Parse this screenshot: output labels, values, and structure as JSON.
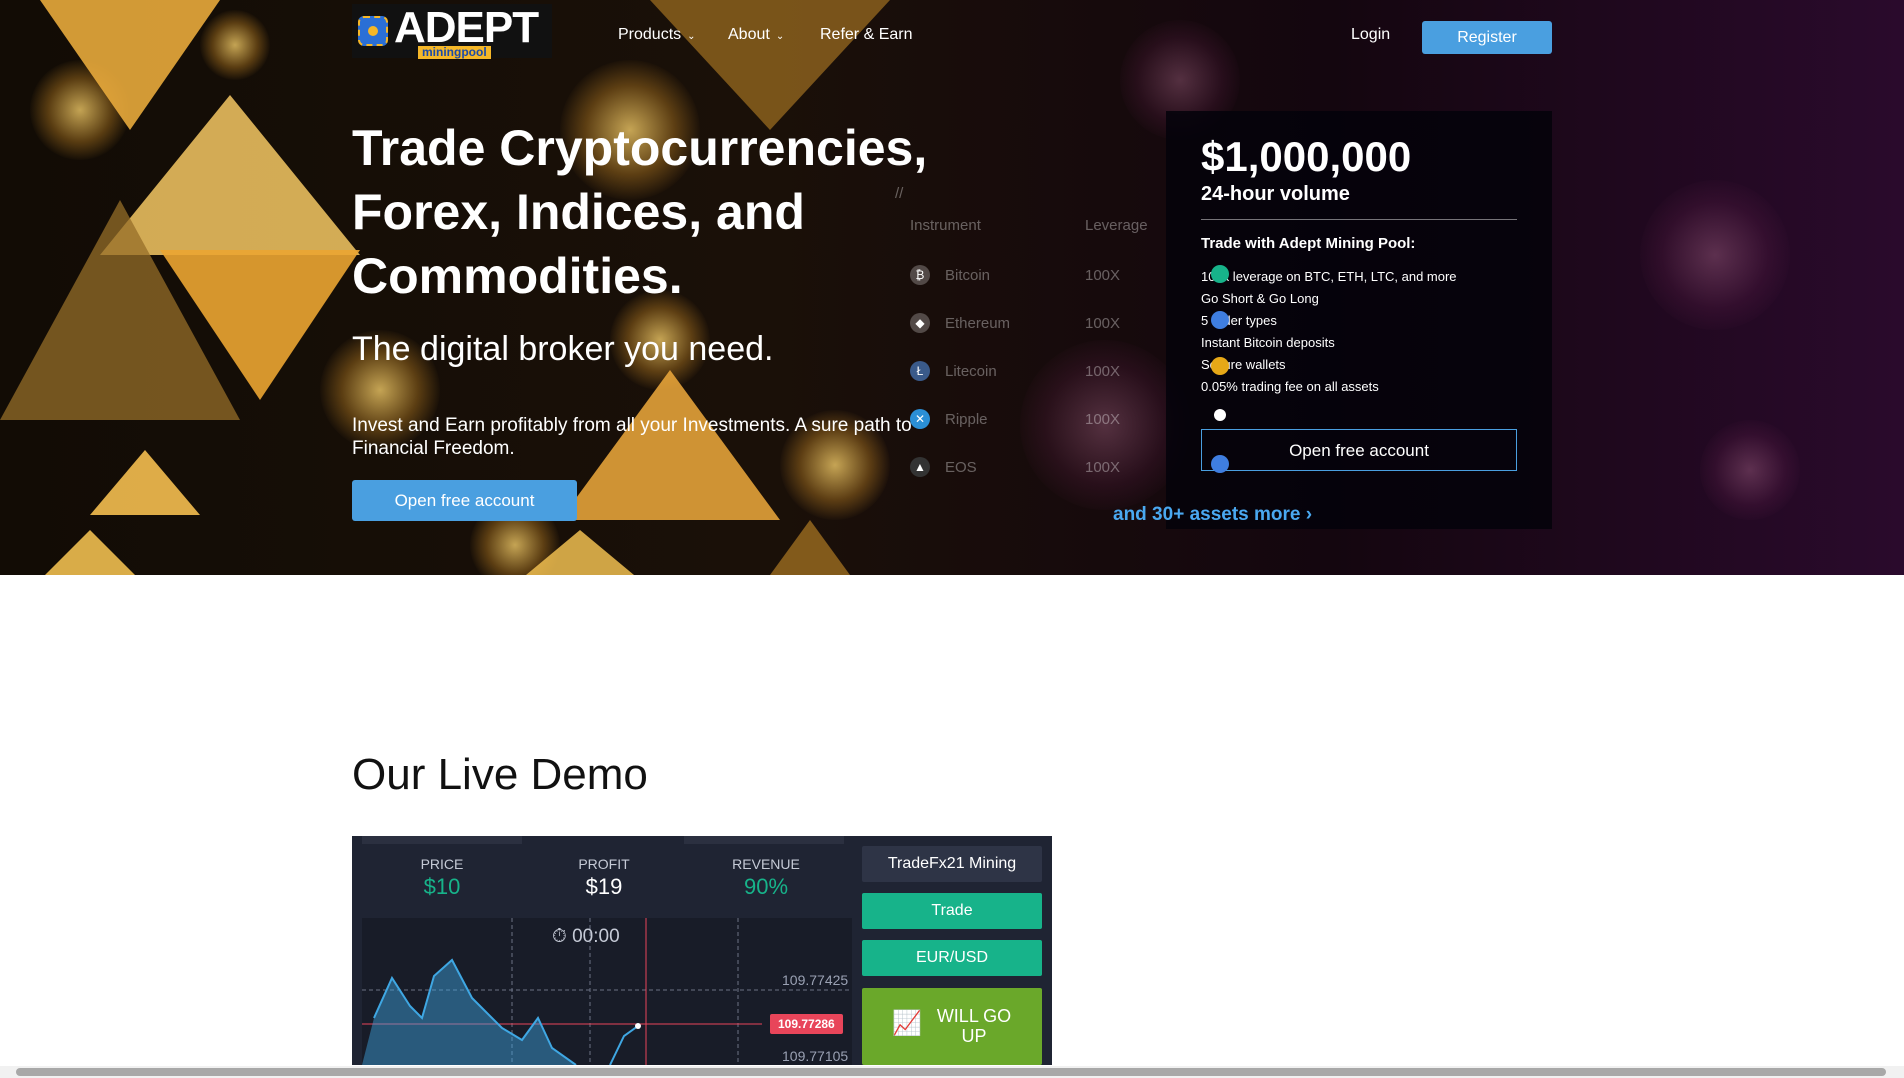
{
  "nav": {
    "logo_text": "ADEPT",
    "logo_sub": "miningpool",
    "items": [
      {
        "label": "Products",
        "has_dropdown": true
      },
      {
        "label": "About",
        "has_dropdown": true
      },
      {
        "label": "Refer & Earn",
        "has_dropdown": false
      }
    ],
    "login": "Login",
    "register": "Register"
  },
  "hero": {
    "headline": "Trade Cryptocurrencies, Forex, Indices, and Commodities.",
    "subheadline": "The digital broker you need.",
    "pitch": "Invest and Earn profitably from all your Investments. A sure path to Financial Freedom.",
    "cta": "Open free account",
    "more_assets": "and 30+ assets more ›"
  },
  "instruments": {
    "marker": "//",
    "headers": [
      "Instrument",
      "Leverage"
    ],
    "rows": [
      {
        "name": "Bitcoin",
        "leverage": "100X",
        "icon": "bitcoin-icon"
      },
      {
        "name": "Ethereum",
        "leverage": "100X",
        "icon": "ethereum-icon"
      },
      {
        "name": "Litecoin",
        "leverage": "100X",
        "icon": "litecoin-icon"
      },
      {
        "name": "Ripple",
        "leverage": "100X",
        "icon": "ripple-icon"
      },
      {
        "name": "EOS",
        "leverage": "100X",
        "icon": "eos-icon"
      }
    ]
  },
  "panel": {
    "volume_value": "$1,000,000",
    "volume_label": "24-hour volume",
    "trade_with": "Trade with Adept Mining Pool:",
    "features": [
      "100x leverage on BTC, ETH, LTC, and more",
      "Go Short & Go Long",
      "5 order types",
      "Instant Bitcoin deposits",
      "Secure wallets",
      "0.05% trading fee on all assets"
    ],
    "cta": "Open free account"
  },
  "demo": {
    "title": "Our Live Demo",
    "price_label": "PRICE",
    "price_value": "$10",
    "profit_label": "PROFIT",
    "profit_value": "$19",
    "revenue_label": "REVENUE",
    "revenue_value": "90%",
    "timer": "00:00",
    "tick_high": "109.77425",
    "tick_current": "109.77286",
    "tick_low": "109.77105",
    "side_title": "TradeFx21 Mining",
    "trade_btn": "Trade",
    "pair_btn": "EUR/USD",
    "up_btn": "WILL GO UP",
    "colors": {
      "green": "#17b38a",
      "up": "#6aa82a",
      "line": "#3fa7e3",
      "marker": "#e8455a"
    }
  }
}
